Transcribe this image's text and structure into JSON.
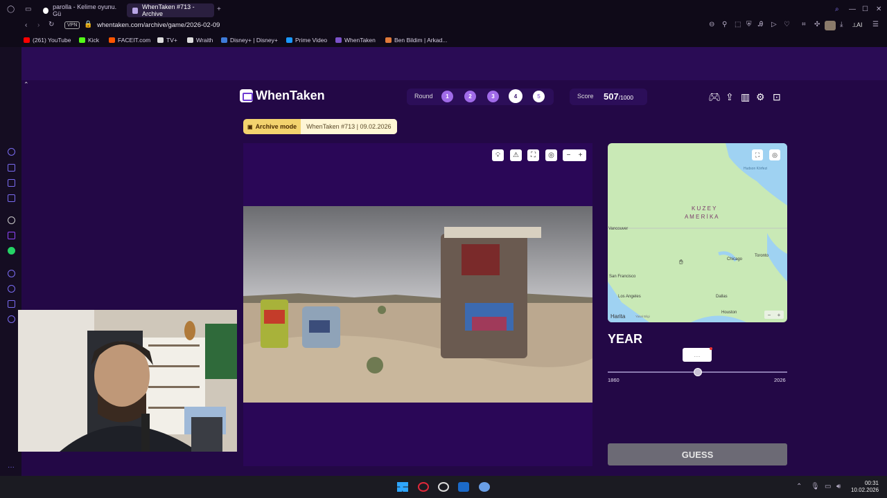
{
  "browser": {
    "tabs": [
      {
        "label": "parolla - Kelime oyunu. Gü",
        "active": false
      },
      {
        "label": "WhenTaken #713 - Archive",
        "active": true
      }
    ],
    "vpn_label": "VPN",
    "url": "whentaken.com/archive/game/2026-02-09",
    "ai_label": "AI",
    "bookmarks": [
      {
        "label": "(261) YouTube",
        "color": "#ff0000"
      },
      {
        "label": "Kick",
        "color": "#53fc18"
      },
      {
        "label": "FACEIT.com",
        "color": "#ff5500"
      },
      {
        "label": "TV+",
        "color": "#dddddd"
      },
      {
        "label": "Wraith",
        "color": "#dddddd"
      },
      {
        "label": "Disney+ | Disney+",
        "color": "#3f7bd9"
      },
      {
        "label": "Prime Video",
        "color": "#1a98ff"
      },
      {
        "label": "WhenTaken",
        "color": "#7b52c9"
      },
      {
        "label": "Ben Bildim | Arkad...",
        "color": "#e07a3a"
      }
    ]
  },
  "game": {
    "brand": "WhenTaken",
    "round_label": "Round",
    "rounds": [
      "1",
      "2",
      "3",
      "4",
      "5"
    ],
    "current_round": 4,
    "score_label": "Score",
    "score_value": "507",
    "score_max": "/1000",
    "archive_label": "Archive mode",
    "archive_info": "WhenTaken #713 | 09.02.2026",
    "map": {
      "continent_line1": "K U Z E Y",
      "continent_line2": "A M E R İ K A",
      "cities": [
        "Vancouver",
        "San Francisco",
        "Los Angeles",
        "Chicago",
        "Toronto",
        "Dallas",
        "Houston"
      ],
      "bay": "Hudson Körfezi",
      "provider": "Harita",
      "legal": "Yasal Bilgi",
      "zoom_minus": "−",
      "zoom_plus": "+"
    },
    "year_heading": "YEAR",
    "year_value": "....",
    "slider_min": "1860",
    "slider_max": "2026",
    "slider_position": 0.5,
    "guess_label": "GUESS"
  },
  "taskbar": {
    "time": "00:31",
    "date": "10.02.2026"
  }
}
